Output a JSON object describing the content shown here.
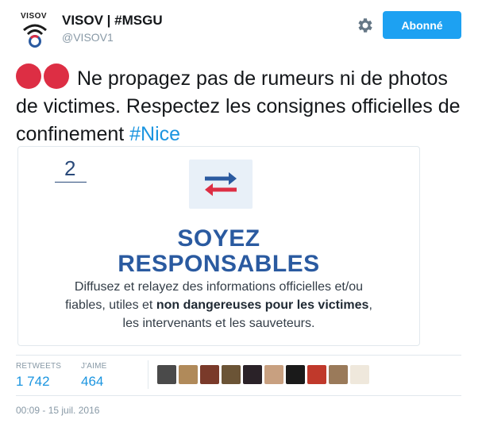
{
  "profile": {
    "avatar_text": "VISOV",
    "full_name": "VISOV | #MSGU",
    "screen_name": "@VISOV1"
  },
  "header": {
    "settings_icon": "gear-icon",
    "follow_label": "Abonné"
  },
  "tweet": {
    "text_main": "Ne propagez pas de rumeurs ni de photos de victimes. Respectez les consignes officielles de confinement ",
    "hashtag": "#Nice",
    "emoji": "two-red-circles"
  },
  "card": {
    "number": "2",
    "icon": "swap-arrows-icon",
    "title_line1": "SOYEZ",
    "title_line2": "RESPONSABLES",
    "body_part1": "Diffusez et relayez des informations officielles et/ou fiables, utiles et ",
    "body_bold1": "non dangereuses pour les victimes",
    "body_part2": ", les intervenants et les sauveteurs."
  },
  "stats": {
    "retweets_label": "RETWEETS",
    "retweets_value": "1 742",
    "likes_label": "J'AIME",
    "likes_value": "464"
  },
  "timestamp": "00:09 - 15 juil. 2016",
  "colors": {
    "accent": "#1da1f2",
    "link": "#1b95e0",
    "emoji_red": "#dd2e44",
    "card_title": "#2a5aa0"
  }
}
